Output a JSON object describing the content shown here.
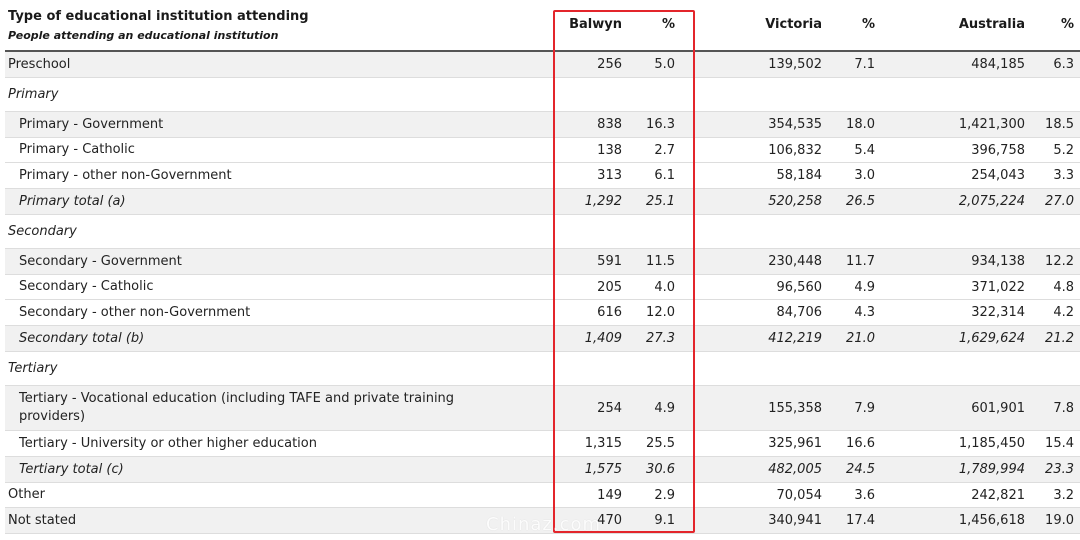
{
  "header": {
    "title": "Type of educational institution attending",
    "subtitle": "People attending an educational institution",
    "columns": [
      "Balwyn",
      "%",
      "Victoria",
      "%",
      "Australia",
      "%"
    ]
  },
  "rows": [
    {
      "label": "Preschool",
      "values": [
        "256",
        "5.0",
        "139,502",
        "7.1",
        "484,185",
        "6.3"
      ]
    },
    {
      "label": "Primary",
      "values": []
    },
    {
      "label": "Primary - Government",
      "values": [
        "838",
        "16.3",
        "354,535",
        "18.0",
        "1,421,300",
        "18.5"
      ]
    },
    {
      "label": "Primary - Catholic",
      "values": [
        "138",
        "2.7",
        "106,832",
        "5.4",
        "396,758",
        "5.2"
      ]
    },
    {
      "label": "Primary - other non-Government",
      "values": [
        "313",
        "6.1",
        "58,184",
        "3.0",
        "254,043",
        "3.3"
      ]
    },
    {
      "label": "Primary total (a)",
      "values": [
        "1,292",
        "25.1",
        "520,258",
        "26.5",
        "2,075,224",
        "27.0"
      ]
    },
    {
      "label": "Secondary",
      "values": []
    },
    {
      "label": "Secondary - Government",
      "values": [
        "591",
        "11.5",
        "230,448",
        "11.7",
        "934,138",
        "12.2"
      ]
    },
    {
      "label": "Secondary - Catholic",
      "values": [
        "205",
        "4.0",
        "96,560",
        "4.9",
        "371,022",
        "4.8"
      ]
    },
    {
      "label": "Secondary - other non-Government",
      "values": [
        "616",
        "12.0",
        "84,706",
        "4.3",
        "322,314",
        "4.2"
      ]
    },
    {
      "label": "Secondary total (b)",
      "values": [
        "1,409",
        "27.3",
        "412,219",
        "21.0",
        "1,629,624",
        "21.2"
      ]
    },
    {
      "label": "Tertiary",
      "values": []
    },
    {
      "label": "Tertiary - Vocational education (including TAFE and private training providers)",
      "values": [
        "254",
        "4.9",
        "155,358",
        "7.9",
        "601,901",
        "7.8"
      ]
    },
    {
      "label": "Tertiary - University or other higher education",
      "values": [
        "1,315",
        "25.5",
        "325,961",
        "16.6",
        "1,185,450",
        "15.4"
      ]
    },
    {
      "label": "Tertiary total (c)",
      "values": [
        "1,575",
        "30.6",
        "482,005",
        "24.5",
        "1,789,994",
        "23.3"
      ]
    },
    {
      "label": "Other",
      "values": [
        "149",
        "2.9",
        "70,054",
        "3.6",
        "242,821",
        "3.2"
      ]
    },
    {
      "label": "Not stated",
      "values": [
        "470",
        "9.1",
        "340,941",
        "17.4",
        "1,456,618",
        "19.0"
      ]
    }
  ],
  "colors": {
    "highlight_border": "#e3252b",
    "row_shading": "#f1f1f1",
    "header_rule": "#555555"
  },
  "watermark": "Chinaz.com"
}
